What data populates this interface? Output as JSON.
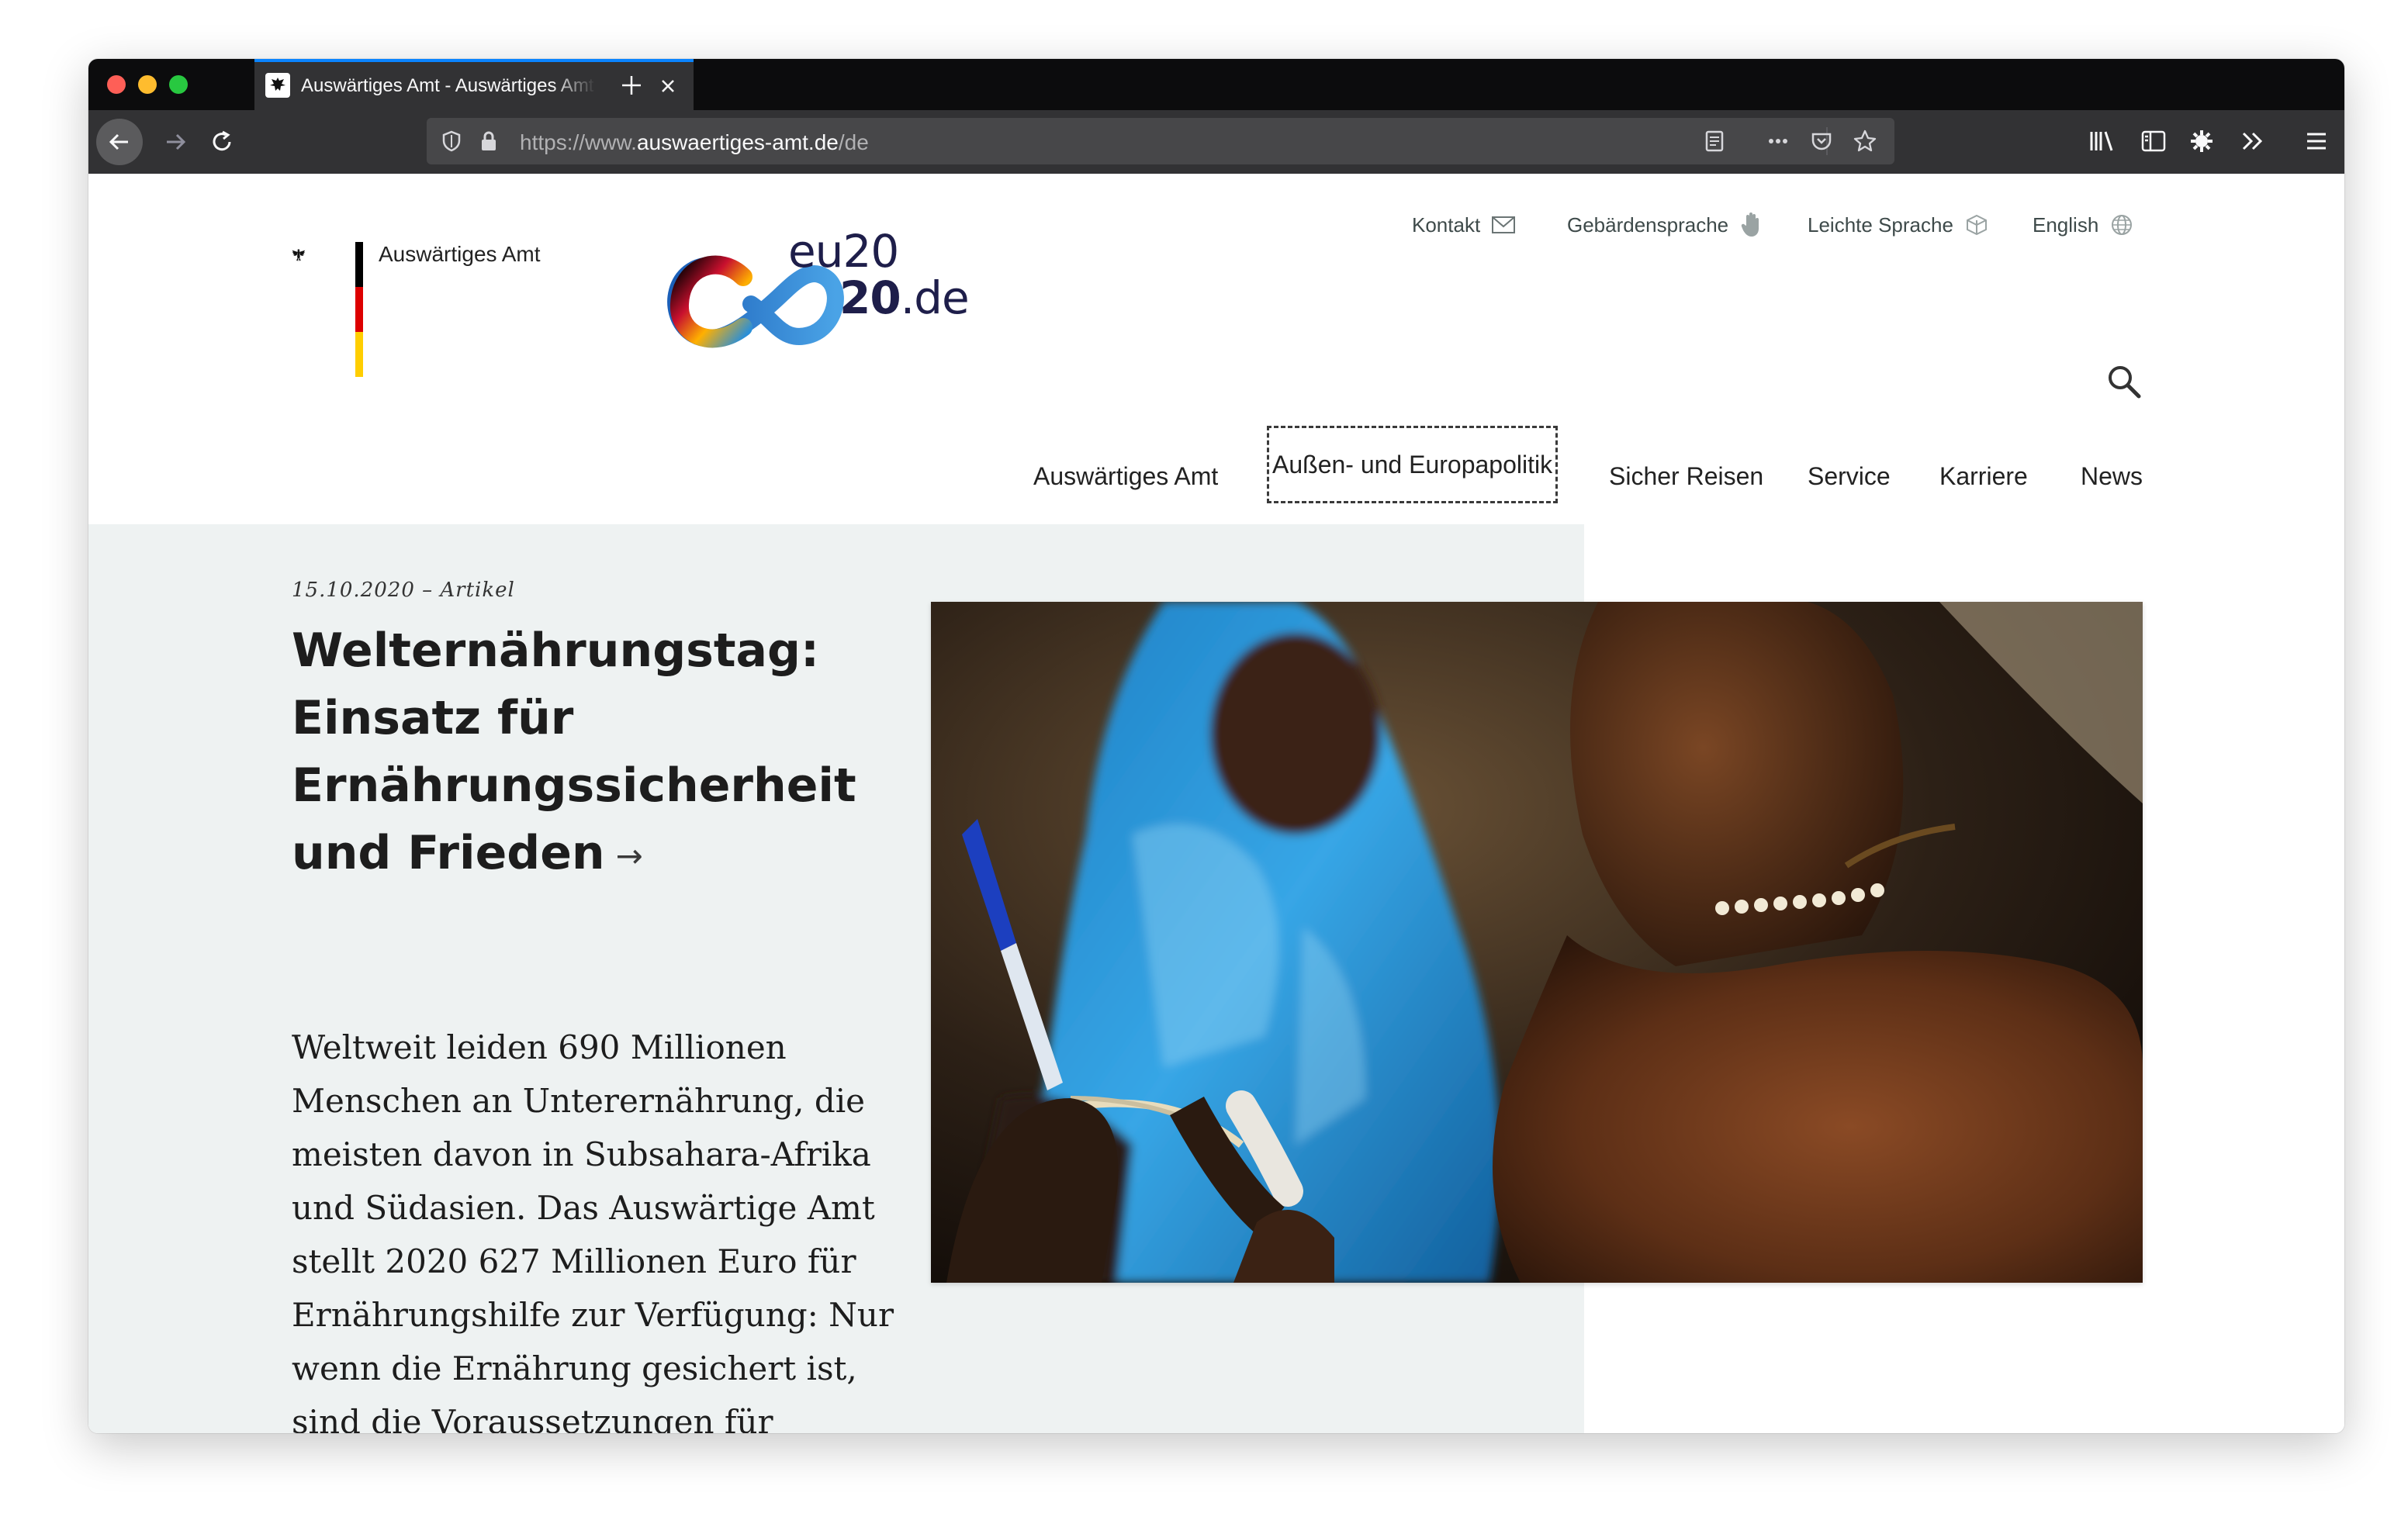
{
  "browser": {
    "tab_title": "Auswärtiges Amt - Auswärtiges Amt",
    "url_prefix": "https://www.",
    "url_domain": "auswaertiges-amt.de",
    "url_path": "/de"
  },
  "utility_nav": {
    "contact": "Kontakt",
    "sign_language": "Gebärdensprache",
    "easy_language": "Leichte Sprache",
    "english": "English"
  },
  "brand": {
    "name": "Auswärtiges Amt",
    "eu_line1": "eu20",
    "eu_line2": "20",
    "eu_suffix": ".de"
  },
  "main_nav": [
    "Auswärtiges Amt",
    "Außen- und Europapolitik",
    "Sicher Reisen",
    "Service",
    "Karriere",
    "News"
  ],
  "article": {
    "meta": "15.10.2020 – Artikel",
    "headline": "Welternährungstag: Einsatz für Ernährungssicherheit und Frieden",
    "arrow": "→",
    "teaser": "Weltweit leiden 690 Millionen Menschen an Unterernährung, die meisten davon in Subsahara-Afrika und Südasien. Das Auswärtige Amt stellt 2020 627 Millionen Euro für Ernährungshilfe zur Verfügung: Nur wenn die Ernährung gesichert ist, sind die Voraussetzungen für Frieden und Stabilität gegeben."
  },
  "colors": {
    "accent_blue": "#0a84ff",
    "hero_background": "#eef2f2"
  },
  "icons": [
    "eagle-icon",
    "mail-icon",
    "hand-icon",
    "easy-language-icon",
    "globe-icon",
    "search-icon"
  ]
}
